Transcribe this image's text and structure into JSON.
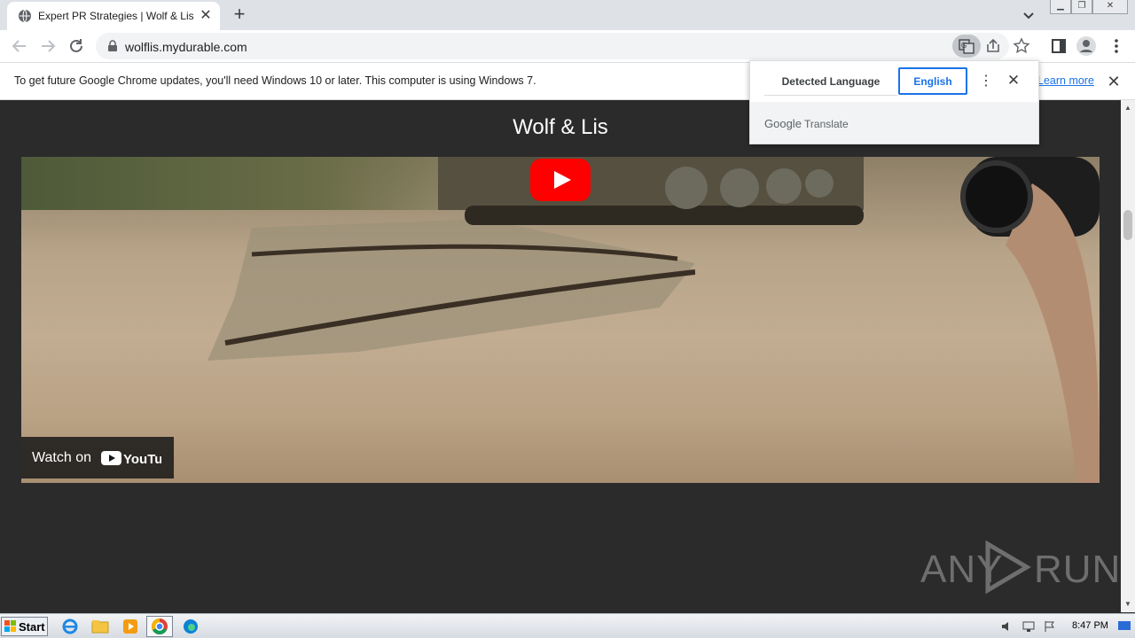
{
  "browser": {
    "tab": {
      "title": "Expert PR Strategies | Wolf & Lis",
      "favicon": "globe-icon"
    },
    "url": "wolflis.mydurable.com",
    "window_controls": [
      "minimize",
      "restore",
      "close"
    ]
  },
  "infobar": {
    "message": "To get future Google Chrome updates, you'll need Windows 10 or later. This computer is using Windows 7.",
    "link": "Learn more"
  },
  "translate_popup": {
    "source_lang": "Detected Language",
    "target_lang": "English",
    "brand": "Google",
    "brand_suffix": "Translate"
  },
  "page": {
    "site_title": "Wolf & Lis",
    "video": {
      "watch_on": "Watch on",
      "youtube_label": "YouTube"
    }
  },
  "watermark": {
    "left": "ANY",
    "right": "RUN"
  },
  "taskbar": {
    "start_label": "Start",
    "clock": "8:47 PM",
    "apps": [
      "ie-icon",
      "folder-icon",
      "media-player-icon",
      "chrome-icon",
      "edge-icon"
    ]
  },
  "colors": {
    "accent": "#1a73e8",
    "page_bg": "#2b2b2b",
    "youtube_red": "#ff0000"
  }
}
